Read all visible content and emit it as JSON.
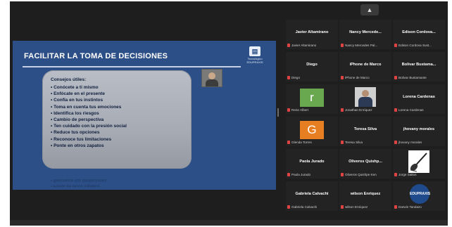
{
  "slide": {
    "title": "FACILITAR LA TOMA DE DECISIONES",
    "logo_text": "Tecnológico EDUPRAXIS",
    "tips_heading": "Consejos útiles:",
    "tips": [
      "• Conócete a ti mismo",
      "• Enfócate en el presente",
      "• Confía en tus instintos",
      "• Toma en cuenta tus emociones",
      "• Identifica los riesgos",
      "• Cambio de perspectiva",
      "• Ten cuidado con la presión social",
      "• Reduce tus opciones",
      "• Reconoce tus limitaciones",
      "• Ponte en otros zapatos"
    ],
    "reflection_lines": [
      "• Ponte en otros zapatos",
      "• Reconoce tus limitaciones"
    ]
  },
  "gallery": {
    "collapse_icon": "chevron-up-icon",
    "tiles": [
      {
        "name": "Javier Altamirano",
        "sub": "Javier Altamirano",
        "type": "name"
      },
      {
        "name": "Nancy  Mercede...",
        "sub": "Nancy Mercedes Pal...",
        "type": "name"
      },
      {
        "name": "Edison  Cordova...",
        "sub": "Edison Cordova Sust...",
        "type": "name"
      },
      {
        "name": "Diego",
        "sub": "Diego",
        "type": "name"
      },
      {
        "name": "iPhone de Marco",
        "sub": "iPhone de Marco",
        "type": "name"
      },
      {
        "name": "Bolivar  Bustama...",
        "sub": "Bolivar Bustamante",
        "type": "name"
      },
      {
        "letter": "r",
        "sub": "Rene Albert",
        "type": "letter",
        "color": "#6aa84f"
      },
      {
        "sub": "Jonathan Enríquez",
        "type": "photo"
      },
      {
        "name": "Lorena  Cardenas",
        "sub": "Lorena Cardenas",
        "type": "name"
      },
      {
        "letter": "G",
        "sub": "Glenda Torres",
        "type": "letter",
        "color": "#e67e22"
      },
      {
        "name": "Teresa Silva",
        "sub": "Teresa Silva",
        "type": "name"
      },
      {
        "name": "jhovany  morales",
        "sub": "jhovany morales",
        "type": "name"
      },
      {
        "name": "Paola Jurado",
        "sub": "Paola Jurado",
        "type": "name"
      },
      {
        "name": "Oliveros  Quishp...",
        "sub": "Oliveros Quishpe Ken",
        "type": "name"
      },
      {
        "sub": "Jorge Saltos",
        "type": "guitar"
      },
      {
        "name": "Gabriela  Calvachi",
        "sub": "Gabriela Calvachi",
        "type": "name"
      },
      {
        "name": "wilson  Enriquez",
        "sub": "wilson Enriquez",
        "type": "name"
      },
      {
        "sub": "Darwin Tandazo",
        "type": "logo",
        "logo_text": "EDUPRAXIS"
      }
    ]
  }
}
